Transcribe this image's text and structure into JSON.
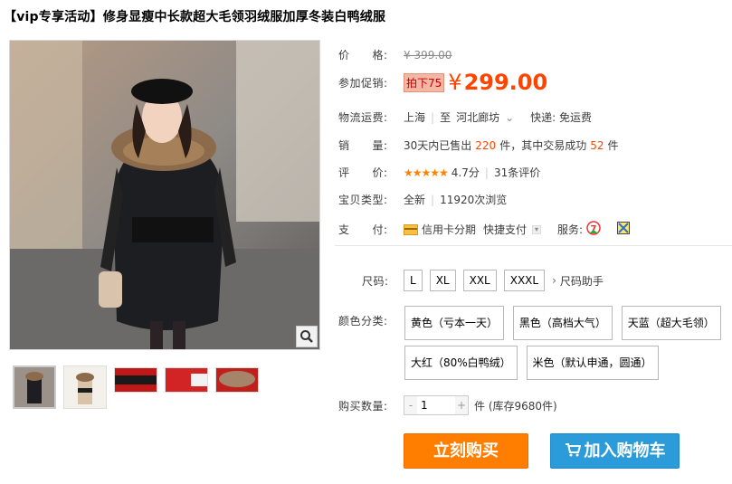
{
  "title": "【vip专享活动】修身显瘦中长款超大毛领羽绒服加厚冬装白鸭绒服",
  "price": {
    "label": "价　　格:",
    "original": "¥ 399.00"
  },
  "promo": {
    "label": "参加促销:",
    "badge": "拍下75",
    "yen": "¥",
    "price": "299.00"
  },
  "shipping": {
    "label": "物流运费:",
    "from": "上海",
    "sep": "|",
    "to_prefix": "至",
    "to": "河北廊坊",
    "express": "快递: 免运费"
  },
  "sales": {
    "label": "销　　量:",
    "prefix": "30天内已售出",
    "sold": "220",
    "mid": "件，其中交易成功",
    "success": "52",
    "suffix": "件"
  },
  "rating": {
    "label": "评　　价:",
    "stars": "★★★★★",
    "score": "4.7分",
    "reviews": "31条评价"
  },
  "type": {
    "label": "宝贝类型:",
    "condition": "全新",
    "views": "11920次浏览"
  },
  "payment": {
    "label": "支　　付:",
    "credit": "信用卡分期",
    "quick": "快捷支付",
    "service_label": "服务:"
  },
  "size": {
    "label": "尺码:",
    "options": [
      "L",
      "XL",
      "XXL",
      "XXXL"
    ],
    "helper": "尺码助手"
  },
  "colors": {
    "label": "颜色分类:",
    "options": [
      "黄色（亏本一天）",
      "黑色（高档大气）",
      "天蓝（超大毛领）",
      "大红（80%白鸭绒）",
      "米色（默认申通，圆通）"
    ]
  },
  "quantity": {
    "label": "购买数量:",
    "minus": "-",
    "value": "1",
    "plus": "+",
    "stock": "件 (库存9680件)"
  },
  "actions": {
    "buy": "立刻购买",
    "cart": "加入购物车"
  },
  "colors_theme": {
    "accent": "#ff4400",
    "buy": "#ff7e00",
    "cart": "#2c9bd9"
  }
}
